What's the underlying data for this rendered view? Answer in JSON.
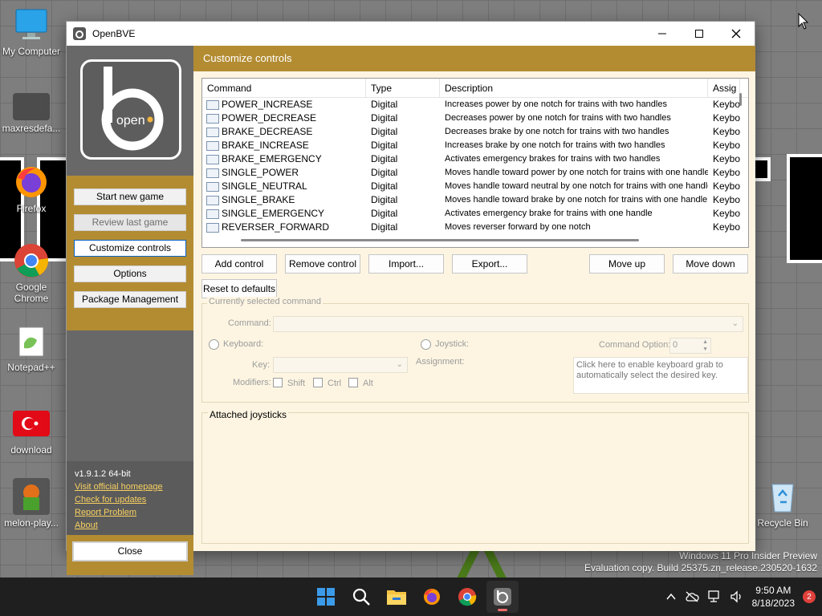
{
  "desktop": {
    "icons": [
      {
        "label": "My Computer",
        "icon": "computer-icon"
      },
      {
        "label": "maxresdefa...",
        "icon": "image-file-icon"
      },
      {
        "label": "Firefox",
        "icon": "firefox-icon"
      },
      {
        "label": "Google Chrome",
        "icon": "chrome-icon"
      },
      {
        "label": "Notepad++",
        "icon": "notepadpp-icon"
      },
      {
        "label": "download",
        "icon": "turkey-flag-icon"
      },
      {
        "label": "melon-play...",
        "icon": "game-icon"
      },
      {
        "label": "Recycle Bin",
        "icon": "recycle-bin-icon"
      }
    ],
    "watermark_line1": "Windows 11 Pro Insider Preview",
    "watermark_line2": "Evaluation copy. Build 25375.zn_release.230520-1632"
  },
  "window": {
    "title": "OpenBVE",
    "logo_text": "open",
    "accent": "#b38c32",
    "sidebar": {
      "buttons": [
        {
          "label": "Start new game",
          "state": "normal"
        },
        {
          "label": "Review last game",
          "state": "disabled"
        },
        {
          "label": "Customize controls",
          "state": "selected"
        },
        {
          "label": "Options",
          "state": "normal"
        },
        {
          "label": "Package Management",
          "state": "normal"
        }
      ],
      "version": "v1.9.1.2 64-bit",
      "links": [
        "Visit official homepage",
        "Check for updates",
        "Report Problem",
        "About"
      ],
      "close_label": "Close"
    },
    "main": {
      "header": "Customize controls",
      "columns": [
        "Command",
        "Type",
        "Description",
        "Assig"
      ],
      "rows": [
        {
          "command": "POWER_INCREASE",
          "type": "Digital",
          "description": "Increases power by one notch for trains with two handles",
          "assignment": "Keybo"
        },
        {
          "command": "POWER_DECREASE",
          "type": "Digital",
          "description": "Decreases power by one notch for trains with two handles",
          "assignment": "Keybo"
        },
        {
          "command": "BRAKE_DECREASE",
          "type": "Digital",
          "description": "Decreases brake by one notch for trains with two handles",
          "assignment": "Keybo"
        },
        {
          "command": "BRAKE_INCREASE",
          "type": "Digital",
          "description": "Increases brake by one notch for trains with two handles",
          "assignment": "Keybo"
        },
        {
          "command": "BRAKE_EMERGENCY",
          "type": "Digital",
          "description": "Activates emergency brakes for trains with two handles",
          "assignment": "Keybo"
        },
        {
          "command": "SINGLE_POWER",
          "type": "Digital",
          "description": "Moves handle toward power by one notch for trains with one handle",
          "assignment": "Keybo"
        },
        {
          "command": "SINGLE_NEUTRAL",
          "type": "Digital",
          "description": "Moves handle toward neutral by one notch for trains with one handle",
          "assignment": "Keybo"
        },
        {
          "command": "SINGLE_BRAKE",
          "type": "Digital",
          "description": "Moves handle toward brake by one notch for trains with one handle",
          "assignment": "Keybo"
        },
        {
          "command": "SINGLE_EMERGENCY",
          "type": "Digital",
          "description": "Activates emergency brake for trains with one handle",
          "assignment": "Keybo"
        },
        {
          "command": "REVERSER_FORWARD",
          "type": "Digital",
          "description": "Moves reverser forward by one notch",
          "assignment": "Keybo"
        }
      ],
      "buttons": {
        "add": "Add control",
        "remove": "Remove control",
        "import": "Import...",
        "export": "Export...",
        "move_up": "Move up",
        "move_down": "Move down",
        "reset": "Reset to defaults"
      },
      "selected_group": {
        "legend": "Currently selected command",
        "command_label": "Command:",
        "keyboard_label": "Keyboard:",
        "joystick_label": "Joystick:",
        "command_option_label": "Command Option:",
        "command_option_value": "0",
        "key_label": "Key:",
        "assignment_label": "Assignment:",
        "modifiers_label": "Modifiers:",
        "shift": "Shift",
        "ctrl": "Ctrl",
        "alt": "Alt",
        "hint": "Click here to enable keyboard grab to automatically select the desired key."
      },
      "joysticks_legend": "Attached joysticks"
    }
  },
  "taskbar": {
    "apps": [
      "start-icon",
      "search-icon",
      "file-explorer-icon",
      "firefox-icon",
      "chrome-icon",
      "openbve-icon"
    ],
    "time": "9:50 AM",
    "date": "8/18/2023",
    "notification_count": "2"
  }
}
